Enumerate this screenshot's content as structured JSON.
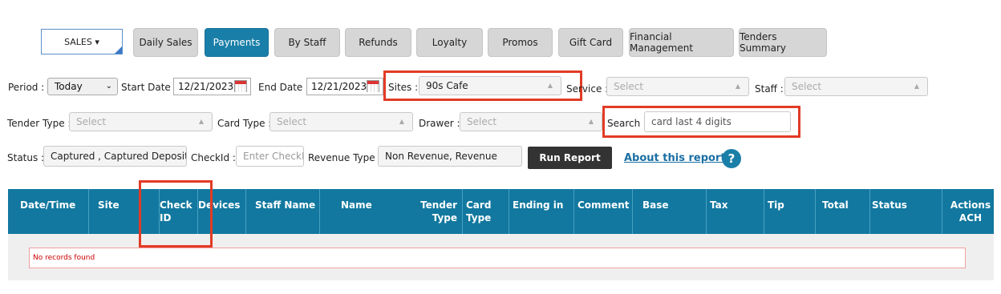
{
  "menu": {
    "sales_label": "SALES ▾"
  },
  "tabs": [
    {
      "label": "Daily Sales"
    },
    {
      "label": "Payments"
    },
    {
      "label": "By Staff"
    },
    {
      "label": "Refunds"
    },
    {
      "label": "Loyalty"
    },
    {
      "label": "Promos"
    },
    {
      "label": "Gift Card"
    },
    {
      "label": "Financial Management"
    },
    {
      "label": "Tenders Summary"
    }
  ],
  "filters": {
    "period_label": "Period :",
    "period_value": "Today",
    "start_label": "Start Date :",
    "start_value": "12/21/2023",
    "end_label": "End Date :",
    "end_value": "12/21/2023",
    "sites_label": "Sites :",
    "sites_value": "90s Cafe",
    "service_label": "Service :",
    "service_value": "Select",
    "staff_label": "Staff :",
    "staff_value": "Select",
    "tender_label": "Tender Type :",
    "tender_value": "Select",
    "card_label": "Card Type :",
    "card_value": "Select",
    "drawer_label": "Drawer :",
    "drawer_value": "Select",
    "search_label": "Search :",
    "search_placeholder": "card last 4 digits",
    "status_label": "Status :",
    "status_value": "Captured , Captured Deposit , C",
    "checkid_label": "CheckId :",
    "checkid_placeholder": "Enter CheckI",
    "revenue_label": "Revenue Type :",
    "revenue_value": "Non Revenue, Revenue"
  },
  "actions": {
    "run_report": "Run Report",
    "about": "About this report",
    "help": "?"
  },
  "table": {
    "headers": [
      "Date/Time",
      "Site",
      "Check ID",
      "Devices",
      "Staff Name",
      "Name",
      "Tender Type",
      "Card Type",
      "Ending in",
      "Comment",
      "Base",
      "Tax",
      "Tip",
      "Total",
      "Status",
      "Actions ACH"
    ],
    "empty_message": "No records found"
  }
}
